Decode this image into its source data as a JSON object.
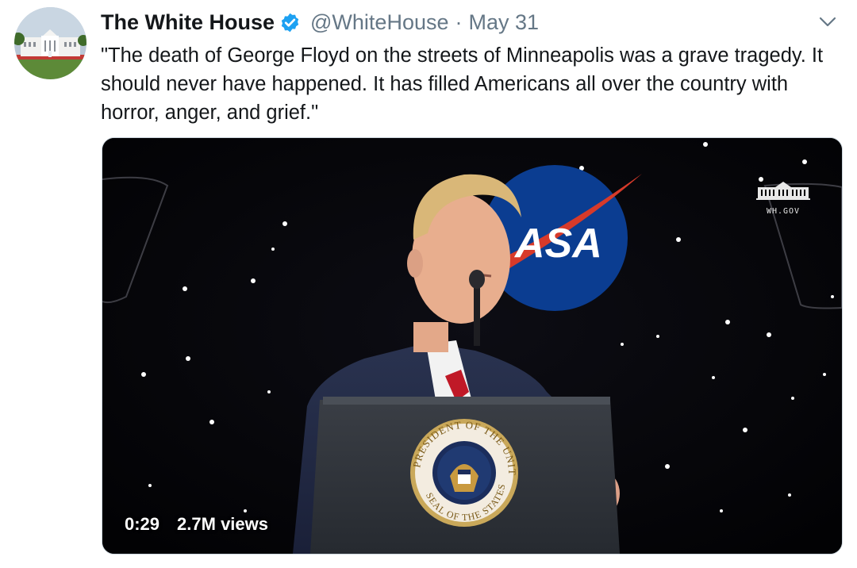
{
  "tweet": {
    "author_name": "The White House",
    "handle": "@WhiteHouse",
    "separator": "·",
    "date": "May 31",
    "text": "\"The death of George Floyd on the streets of Minneapolis was a grave tragedy. It should never have happened. It has filled Americans all over the country with horror, anger, and grief.\""
  },
  "icons": {
    "verified": "verified-badge-icon",
    "more": "chevron-down-icon"
  },
  "media": {
    "type": "video",
    "duration": "0:29",
    "views": "2.7M views",
    "watermark_text": "WH.GOV",
    "backdrop_logo_text": "ASA",
    "seal_text_top": "PRESIDENT OF THE UNITED",
    "seal_text_bottom": "SEAL OF THE STATES"
  },
  "colors": {
    "verified": "#1da1f2",
    "secondary_text": "#657786",
    "primary_text": "#14171a"
  }
}
